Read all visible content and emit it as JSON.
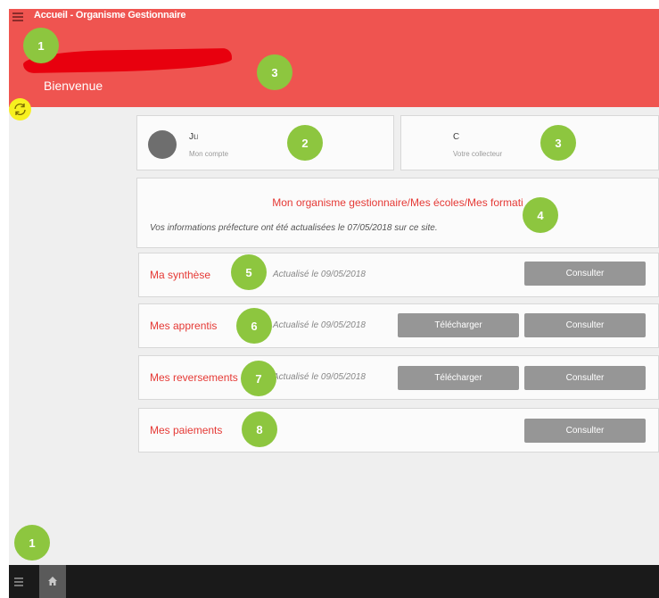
{
  "header": {
    "title": "Accueil - Organisme Gestionnaire",
    "welcome": "Bienvenue"
  },
  "account_card": {
    "name": "Ju",
    "subtitle": "Mon compte"
  },
  "collector_card": {
    "name": "C",
    "subtitle": "Votre collecteur"
  },
  "info_card": {
    "title": "Mon organisme gestionnaire/Mes écoles/Mes formati",
    "text": "Vos informations préfecture ont été actualisées le 07/05/2018 sur ce site."
  },
  "rows": [
    {
      "label": "Ma synthèse",
      "date": "Actualisé le 09/05/2018",
      "consult": "Consulter"
    },
    {
      "label": "Mes apprentis",
      "date": "Actualisé le 09/05/2018",
      "download": "Télécharger",
      "consult": "Consulter"
    },
    {
      "label": "Mes reversements",
      "date": "Actualisé le 09/05/2018",
      "download": "Télécharger",
      "consult": "Consulter"
    },
    {
      "label": "Mes paiements",
      "consult": "Consulter"
    }
  ],
  "badges": [
    "1",
    "2",
    "3",
    "3",
    "4",
    "5",
    "6",
    "7",
    "8",
    "1"
  ],
  "icons": {
    "menu": "hamburger-icon",
    "refresh": "refresh-icon",
    "home": "home-icon"
  },
  "colors": {
    "header": "#ef5450",
    "accent_text": "#e53935",
    "badge": "#8dc63f",
    "button": "#969696",
    "bottom_bar": "#1a1a1a"
  }
}
